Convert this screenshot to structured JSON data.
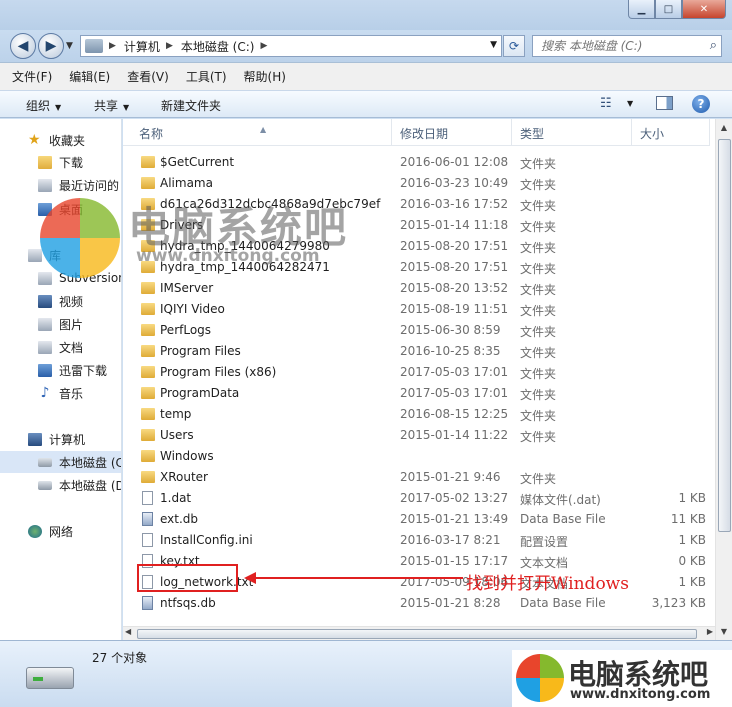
{
  "window": {
    "minimize_glyph": "▁",
    "maximize_glyph": "□",
    "close_glyph": "✕"
  },
  "address": {
    "crumbs": [
      "计算机",
      "本地磁盘 (C:)"
    ],
    "search_placeholder": "搜索 本地磁盘 (C:)"
  },
  "menubar": [
    "文件(F)",
    "编辑(E)",
    "查看(V)",
    "工具(T)",
    "帮助(H)"
  ],
  "toolbar": {
    "organize": "组织",
    "share": "共享",
    "new_folder": "新建文件夹"
  },
  "nav": {
    "favorites": "收藏夹",
    "downloads": "下载",
    "recent": "最近访问的",
    "desktop": "桌面",
    "libraries": "库",
    "subversion": "Subversion",
    "videos": "视频",
    "pictures": "图片",
    "documents": "文档",
    "thunder": "迅雷下载",
    "music": "音乐",
    "computer": "计算机",
    "local_c": "本地磁盘 (C",
    "local_d": "本地磁盘 (D",
    "network": "网络"
  },
  "columns": {
    "name": "名称",
    "date": "修改日期",
    "type": "类型",
    "size": "大小"
  },
  "files": [
    {
      "name": "$GetCurrent",
      "date": "2016-06-01 12:08",
      "type": "文件夹",
      "size": "",
      "kind": "folder"
    },
    {
      "name": "Alimama",
      "date": "2016-03-23 10:49",
      "type": "文件夹",
      "size": "",
      "kind": "folder"
    },
    {
      "name": "d61ca26d312dcbc4868a9d7ebc79ef",
      "date": "2016-03-16 17:52",
      "type": "文件夹",
      "size": "",
      "kind": "folder"
    },
    {
      "name": "Drivers",
      "date": "2015-01-14 11:18",
      "type": "文件夹",
      "size": "",
      "kind": "folder"
    },
    {
      "name": "hydra_tmp_1440064279980",
      "date": "2015-08-20 17:51",
      "type": "文件夹",
      "size": "",
      "kind": "folder"
    },
    {
      "name": "hydra_tmp_1440064282471",
      "date": "2015-08-20 17:51",
      "type": "文件夹",
      "size": "",
      "kind": "folder"
    },
    {
      "name": "IMServer",
      "date": "2015-08-20 13:52",
      "type": "文件夹",
      "size": "",
      "kind": "folder"
    },
    {
      "name": "IQIYI Video",
      "date": "2015-08-19 11:51",
      "type": "文件夹",
      "size": "",
      "kind": "folder"
    },
    {
      "name": "PerfLogs",
      "date": "2015-06-30 8:59",
      "type": "文件夹",
      "size": "",
      "kind": "folder"
    },
    {
      "name": "Program Files",
      "date": "2016-10-25 8:35",
      "type": "文件夹",
      "size": "",
      "kind": "folder"
    },
    {
      "name": "Program Files (x86)",
      "date": "2017-05-03 17:01",
      "type": "文件夹",
      "size": "",
      "kind": "folder"
    },
    {
      "name": "ProgramData",
      "date": "2017-05-03 17:01",
      "type": "文件夹",
      "size": "",
      "kind": "folder"
    },
    {
      "name": "temp",
      "date": "2016-08-15 12:25",
      "type": "文件夹",
      "size": "",
      "kind": "folder"
    },
    {
      "name": "Users",
      "date": "2015-01-14 11:22",
      "type": "文件夹",
      "size": "",
      "kind": "folder"
    },
    {
      "name": "Windows",
      "date": "",
      "type": "",
      "size": "",
      "kind": "folder"
    },
    {
      "name": "XRouter",
      "date": "2015-01-21 9:46",
      "type": "文件夹",
      "size": "",
      "kind": "folder"
    },
    {
      "name": "1.dat",
      "date": "2017-05-02 13:27",
      "type": "媒体文件(.dat)",
      "size": "1 KB",
      "kind": "file"
    },
    {
      "name": "ext.db",
      "date": "2015-01-21 13:49",
      "type": "Data Base File",
      "size": "11 KB",
      "kind": "db"
    },
    {
      "name": "InstallConfig.ini",
      "date": "2016-03-17 8:21",
      "type": "配置设置",
      "size": "1 KB",
      "kind": "file"
    },
    {
      "name": "key.txt",
      "date": "2015-01-15 17:17",
      "type": "文本文档",
      "size": "0 KB",
      "kind": "file"
    },
    {
      "name": "log_network.txt",
      "date": "2017-05-09 18:06",
      "type": "文本文档",
      "size": "1 KB",
      "kind": "file"
    },
    {
      "name": "ntfsqs.db",
      "date": "2015-01-21 8:28",
      "type": "Data Base File",
      "size": "3,123 KB",
      "kind": "db"
    }
  ],
  "annotation": "找到并打开Windows",
  "status": {
    "count": "27 个对象"
  },
  "watermark": {
    "title": "电脑系统吧",
    "url": "www.dnxitong.com"
  },
  "colors": {
    "highlight": "#e02020",
    "folder": "#e6b547",
    "logo": [
      "#e8452c",
      "#85b92d",
      "#1fa0e3",
      "#f8b91a"
    ]
  }
}
